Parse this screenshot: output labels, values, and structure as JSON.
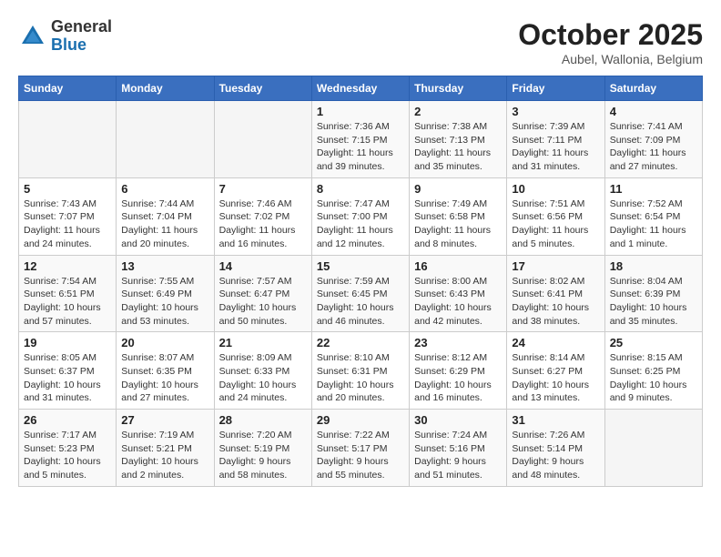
{
  "header": {
    "logo_line1": "General",
    "logo_line2": "Blue",
    "month": "October 2025",
    "location": "Aubel, Wallonia, Belgium"
  },
  "weekdays": [
    "Sunday",
    "Monday",
    "Tuesday",
    "Wednesday",
    "Thursday",
    "Friday",
    "Saturday"
  ],
  "weeks": [
    [
      {
        "day": "",
        "info": ""
      },
      {
        "day": "",
        "info": ""
      },
      {
        "day": "",
        "info": ""
      },
      {
        "day": "1",
        "info": "Sunrise: 7:36 AM\nSunset: 7:15 PM\nDaylight: 11 hours and 39 minutes."
      },
      {
        "day": "2",
        "info": "Sunrise: 7:38 AM\nSunset: 7:13 PM\nDaylight: 11 hours and 35 minutes."
      },
      {
        "day": "3",
        "info": "Sunrise: 7:39 AM\nSunset: 7:11 PM\nDaylight: 11 hours and 31 minutes."
      },
      {
        "day": "4",
        "info": "Sunrise: 7:41 AM\nSunset: 7:09 PM\nDaylight: 11 hours and 27 minutes."
      }
    ],
    [
      {
        "day": "5",
        "info": "Sunrise: 7:43 AM\nSunset: 7:07 PM\nDaylight: 11 hours and 24 minutes."
      },
      {
        "day": "6",
        "info": "Sunrise: 7:44 AM\nSunset: 7:04 PM\nDaylight: 11 hours and 20 minutes."
      },
      {
        "day": "7",
        "info": "Sunrise: 7:46 AM\nSunset: 7:02 PM\nDaylight: 11 hours and 16 minutes."
      },
      {
        "day": "8",
        "info": "Sunrise: 7:47 AM\nSunset: 7:00 PM\nDaylight: 11 hours and 12 minutes."
      },
      {
        "day": "9",
        "info": "Sunrise: 7:49 AM\nSunset: 6:58 PM\nDaylight: 11 hours and 8 minutes."
      },
      {
        "day": "10",
        "info": "Sunrise: 7:51 AM\nSunset: 6:56 PM\nDaylight: 11 hours and 5 minutes."
      },
      {
        "day": "11",
        "info": "Sunrise: 7:52 AM\nSunset: 6:54 PM\nDaylight: 11 hours and 1 minute."
      }
    ],
    [
      {
        "day": "12",
        "info": "Sunrise: 7:54 AM\nSunset: 6:51 PM\nDaylight: 10 hours and 57 minutes."
      },
      {
        "day": "13",
        "info": "Sunrise: 7:55 AM\nSunset: 6:49 PM\nDaylight: 10 hours and 53 minutes."
      },
      {
        "day": "14",
        "info": "Sunrise: 7:57 AM\nSunset: 6:47 PM\nDaylight: 10 hours and 50 minutes."
      },
      {
        "day": "15",
        "info": "Sunrise: 7:59 AM\nSunset: 6:45 PM\nDaylight: 10 hours and 46 minutes."
      },
      {
        "day": "16",
        "info": "Sunrise: 8:00 AM\nSunset: 6:43 PM\nDaylight: 10 hours and 42 minutes."
      },
      {
        "day": "17",
        "info": "Sunrise: 8:02 AM\nSunset: 6:41 PM\nDaylight: 10 hours and 38 minutes."
      },
      {
        "day": "18",
        "info": "Sunrise: 8:04 AM\nSunset: 6:39 PM\nDaylight: 10 hours and 35 minutes."
      }
    ],
    [
      {
        "day": "19",
        "info": "Sunrise: 8:05 AM\nSunset: 6:37 PM\nDaylight: 10 hours and 31 minutes."
      },
      {
        "day": "20",
        "info": "Sunrise: 8:07 AM\nSunset: 6:35 PM\nDaylight: 10 hours and 27 minutes."
      },
      {
        "day": "21",
        "info": "Sunrise: 8:09 AM\nSunset: 6:33 PM\nDaylight: 10 hours and 24 minutes."
      },
      {
        "day": "22",
        "info": "Sunrise: 8:10 AM\nSunset: 6:31 PM\nDaylight: 10 hours and 20 minutes."
      },
      {
        "day": "23",
        "info": "Sunrise: 8:12 AM\nSunset: 6:29 PM\nDaylight: 10 hours and 16 minutes."
      },
      {
        "day": "24",
        "info": "Sunrise: 8:14 AM\nSunset: 6:27 PM\nDaylight: 10 hours and 13 minutes."
      },
      {
        "day": "25",
        "info": "Sunrise: 8:15 AM\nSunset: 6:25 PM\nDaylight: 10 hours and 9 minutes."
      }
    ],
    [
      {
        "day": "26",
        "info": "Sunrise: 7:17 AM\nSunset: 5:23 PM\nDaylight: 10 hours and 5 minutes."
      },
      {
        "day": "27",
        "info": "Sunrise: 7:19 AM\nSunset: 5:21 PM\nDaylight: 10 hours and 2 minutes."
      },
      {
        "day": "28",
        "info": "Sunrise: 7:20 AM\nSunset: 5:19 PM\nDaylight: 9 hours and 58 minutes."
      },
      {
        "day": "29",
        "info": "Sunrise: 7:22 AM\nSunset: 5:17 PM\nDaylight: 9 hours and 55 minutes."
      },
      {
        "day": "30",
        "info": "Sunrise: 7:24 AM\nSunset: 5:16 PM\nDaylight: 9 hours and 51 minutes."
      },
      {
        "day": "31",
        "info": "Sunrise: 7:26 AM\nSunset: 5:14 PM\nDaylight: 9 hours and 48 minutes."
      },
      {
        "day": "",
        "info": ""
      }
    ]
  ]
}
